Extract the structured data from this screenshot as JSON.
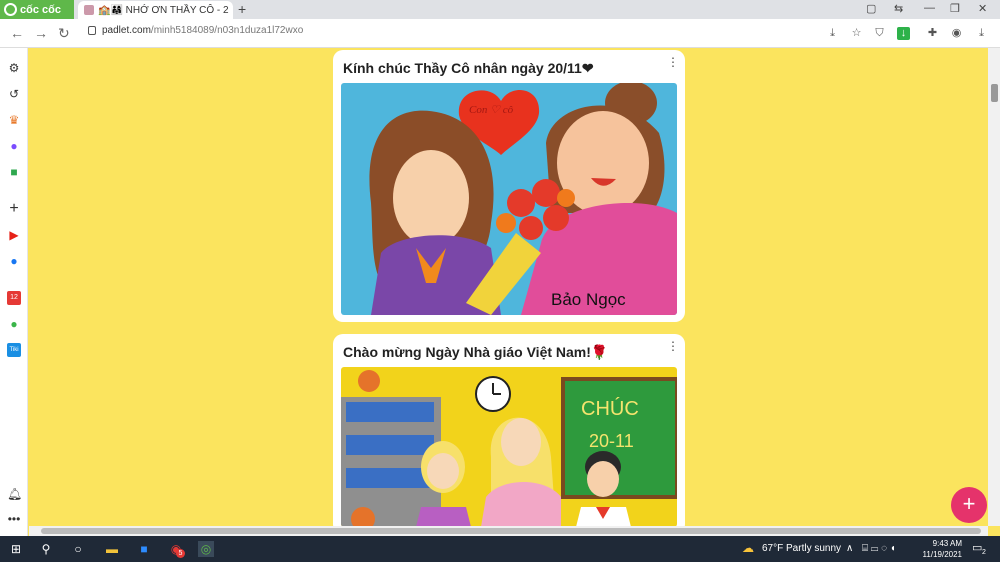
{
  "browser": {
    "brand": "cốc cốc",
    "tab_title": "🏫👨‍👩‍👧 NHỚ ƠN THẦY CÔ - 2",
    "url_host": "padlet.com",
    "url_path": "/minh5184089/n03n1duza1l72wxo"
  },
  "posts": [
    {
      "title": "Kính chúc Thầy Cô nhân ngày 20/11❤",
      "signature": "Bảo Ngọc",
      "heart_text": "Con ♡ cô"
    },
    {
      "title": "Chào mừng Ngày Nhà giáo Việt Nam!🌹",
      "board_text_1": "CHÚC",
      "board_text_2": "20-11"
    }
  ],
  "fab_label": "+",
  "taskbar": {
    "weather": "67°F  Partly sunny",
    "time": "9:43 AM",
    "date": "11/19/2021",
    "notification_count": "2",
    "chrome_badge": "5"
  },
  "colors": {
    "board_bg": "#fbe45e",
    "fab": "#e5336b",
    "brand": "#5fb84a"
  }
}
